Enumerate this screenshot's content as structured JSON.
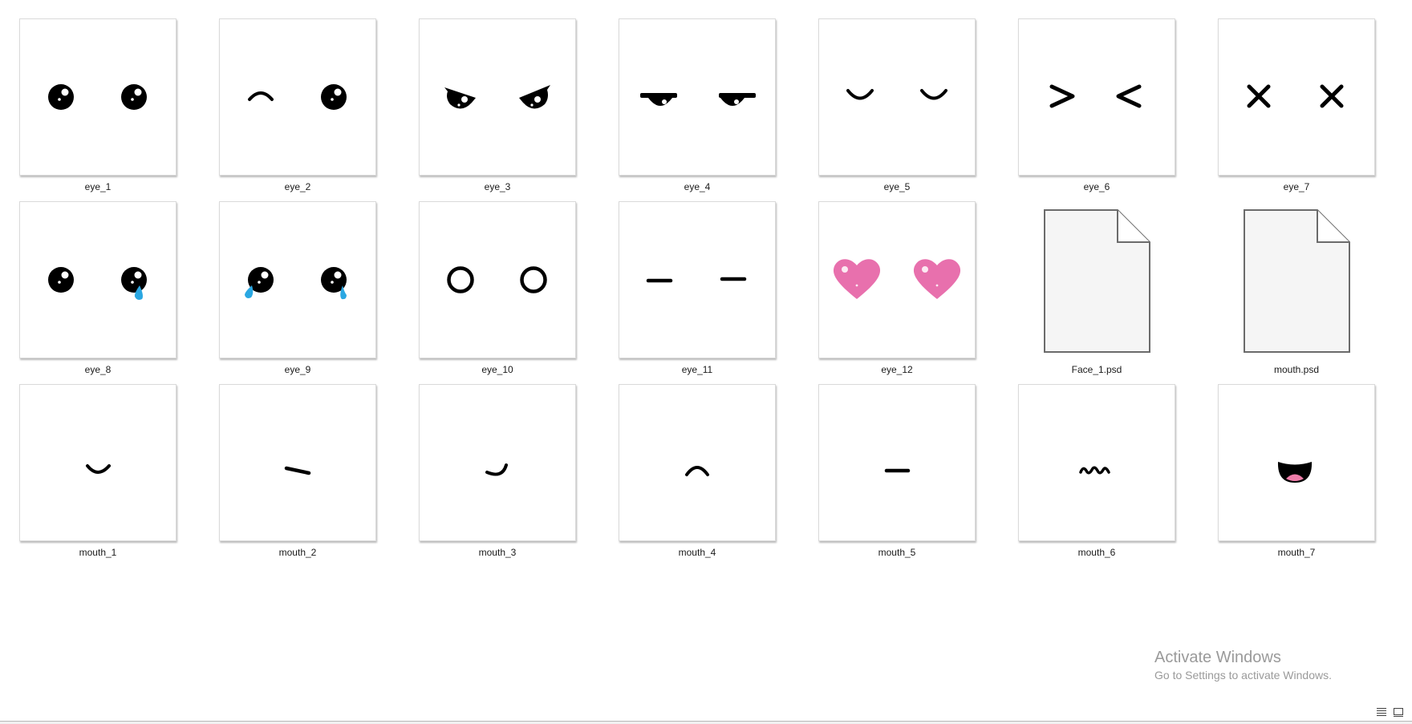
{
  "files": {
    "eye_1": "eye_1",
    "eye_2": "eye_2",
    "eye_3": "eye_3",
    "eye_4": "eye_4",
    "eye_5": "eye_5",
    "eye_6": "eye_6",
    "eye_7": "eye_7",
    "eye_8": "eye_8",
    "eye_9": "eye_9",
    "eye_10": "eye_10",
    "eye_11": "eye_11",
    "eye_12": "eye_12",
    "face_psd": "Face_1.psd",
    "mouth_psd": "mouth.psd",
    "mouth_1": "mouth_1",
    "mouth_2": "mouth_2",
    "mouth_3": "mouth_3",
    "mouth_4": "mouth_4",
    "mouth_5": "mouth_5",
    "mouth_6": "mouth_6",
    "mouth_7": "mouth_7"
  },
  "watermark": {
    "title": "Activate Windows",
    "subtitle": "Go to Settings to activate Windows."
  },
  "view_buttons": [
    "details-view-icon",
    "large-icons-view-icon"
  ],
  "colors": {
    "tear": "#2aa7e2",
    "heart": "#e870ad",
    "mouth_inner": "#ee7ca8"
  }
}
